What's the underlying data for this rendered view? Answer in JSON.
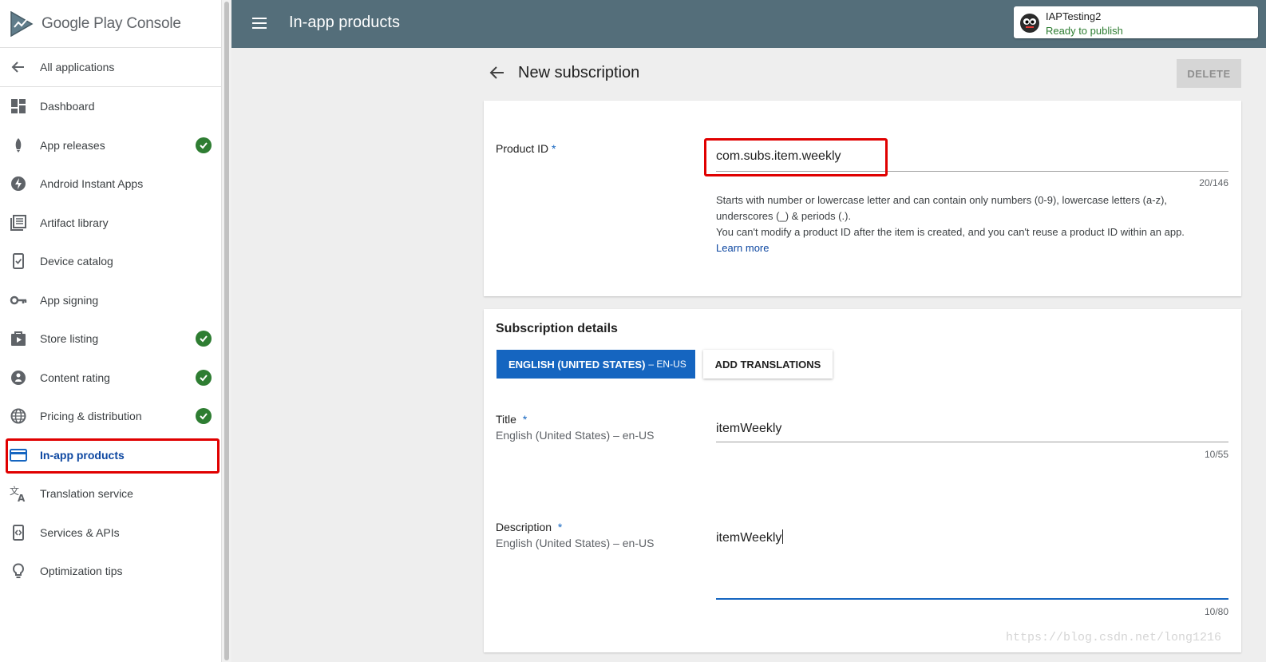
{
  "logo": {
    "brand": "Google Play",
    "product": "Console"
  },
  "sidebar": {
    "items": [
      {
        "label": "All applications",
        "icon": "arrow-left-icon",
        "done": false
      },
      {
        "label": "Dashboard",
        "icon": "dashboard-icon",
        "done": false
      },
      {
        "label": "App releases",
        "icon": "rocket-icon",
        "done": true
      },
      {
        "label": "Android Instant Apps",
        "icon": "bolt-icon",
        "done": false
      },
      {
        "label": "Artifact library",
        "icon": "library-icon",
        "done": false
      },
      {
        "label": "Device catalog",
        "icon": "device-icon",
        "done": false
      },
      {
        "label": "App signing",
        "icon": "key-icon",
        "done": false
      },
      {
        "label": "Store listing",
        "icon": "play-store-icon",
        "done": true
      },
      {
        "label": "Content rating",
        "icon": "rating-icon",
        "done": true
      },
      {
        "label": "Pricing & distribution",
        "icon": "globe-icon",
        "done": true
      },
      {
        "label": "In-app products",
        "icon": "credit-card-icon",
        "done": false,
        "active": true
      },
      {
        "label": "Translation service",
        "icon": "translate-icon",
        "done": false
      },
      {
        "label": "Services & APIs",
        "icon": "api-icon",
        "done": false
      },
      {
        "label": "Optimization tips",
        "icon": "lightbulb-icon",
        "done": false
      }
    ]
  },
  "topbar": {
    "title": "In-app products",
    "app_name": "IAPTesting2",
    "app_status": "Ready to publish"
  },
  "page": {
    "title": "New subscription",
    "delete_label": "DELETE"
  },
  "product_id": {
    "label": "Product ID",
    "required_mark": "*",
    "value": "com.subs.item.weekly",
    "counter": "20/146",
    "help_line1": "Starts with number or lowercase letter and can contain only numbers (0-9), lowercase letters (a-z), underscores (_) & periods (.).",
    "help_line2": "You can't modify a product ID after the item is created, and you can't reuse a product ID within an app.",
    "learn_more": "Learn more"
  },
  "details": {
    "section_title": "Subscription details",
    "language_button": "ENGLISH (UNITED STATES)",
    "language_code": "– EN-US",
    "add_translations": "ADD TRANSLATIONS",
    "title_field": {
      "label": "Title",
      "required_mark": "*",
      "locale": "English (United States) – en-US",
      "value": "itemWeekly",
      "counter": "10/55"
    },
    "description_field": {
      "label": "Description",
      "required_mark": "*",
      "locale": "English (United States) – en-US",
      "value": "itemWeekly",
      "counter": "10/80"
    }
  },
  "watermark": "https://blog.csdn.net/long1216",
  "colors": {
    "topbar": "#546e7a",
    "accent": "#1565c0",
    "success": "#2e7d32",
    "highlight": "#e00000"
  }
}
